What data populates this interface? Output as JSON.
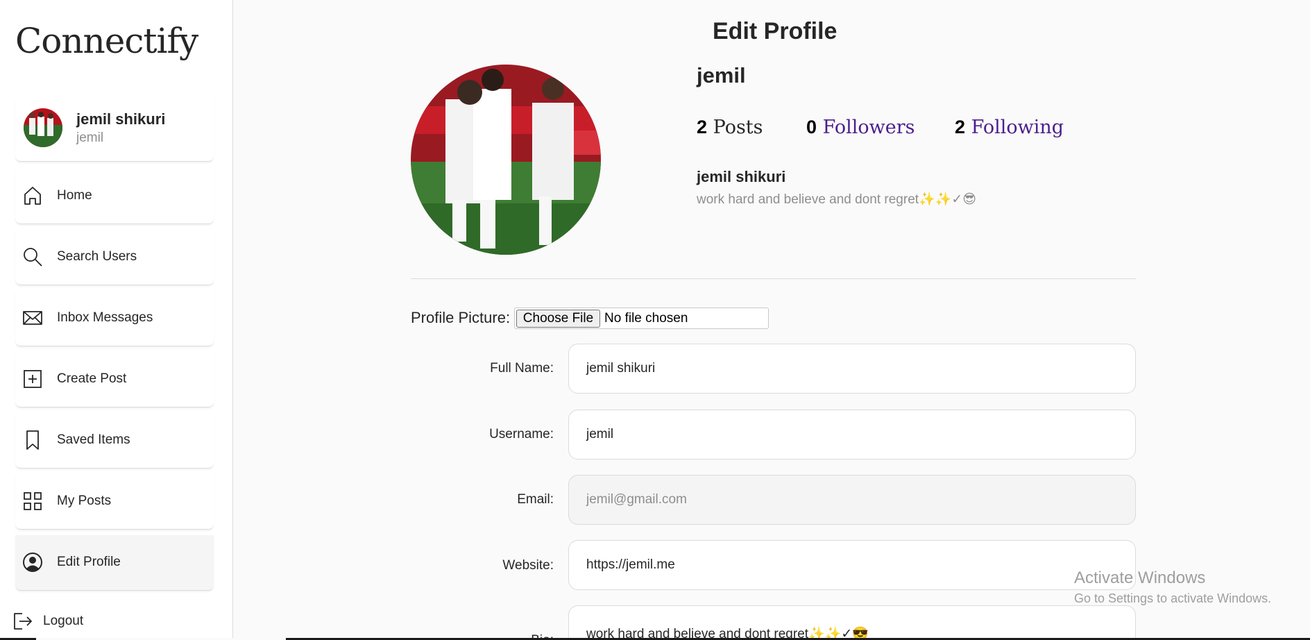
{
  "app": {
    "name": "Connectify"
  },
  "sidebar": {
    "user": {
      "full_name": "jemil shikuri",
      "username": "jemil"
    },
    "items": [
      {
        "label": "Home",
        "icon": "home-icon"
      },
      {
        "label": "Search Users",
        "icon": "search-icon"
      },
      {
        "label": "Inbox Messages",
        "icon": "envelope-icon"
      },
      {
        "label": "Create Post",
        "icon": "plus-square-icon"
      },
      {
        "label": "Saved Items",
        "icon": "bookmark-icon"
      },
      {
        "label": "My Posts",
        "icon": "grid-icon"
      },
      {
        "label": "Edit Profile",
        "icon": "user-circle-icon",
        "active": true
      }
    ],
    "logout": {
      "label": "Logout",
      "icon": "logout-icon"
    }
  },
  "page": {
    "title": "Edit Profile"
  },
  "profile": {
    "username": "jemil",
    "posts_count": "2",
    "posts_label": "Posts",
    "followers_count": "0",
    "followers_label": "Followers",
    "following_count": "2",
    "following_label": "Following",
    "full_name": "jemil shikuri",
    "bio": "work hard and believe and dont regret✨✨✓😎"
  },
  "form": {
    "picture_label": "Profile Picture:",
    "choose_file_label": "Choose File",
    "no_file_text": "No file chosen",
    "fields": {
      "full_name": {
        "label": "Full Name:",
        "value": "jemil shikuri"
      },
      "username": {
        "label": "Username:",
        "value": "jemil"
      },
      "email": {
        "label": "Email:",
        "value": "jemil@gmail.com"
      },
      "website": {
        "label": "Website:",
        "value": "https://jemil.me"
      },
      "bio": {
        "label": "Bio:",
        "value": "work hard and believe  and dont regret✨✨✓😎"
      }
    }
  },
  "watermark": {
    "title": "Activate Windows",
    "subtitle": "Go to Settings to activate Windows."
  },
  "colors": {
    "link": "#4b1e8e",
    "border": "#dbdbdb",
    "muted": "#8e8e8e"
  }
}
